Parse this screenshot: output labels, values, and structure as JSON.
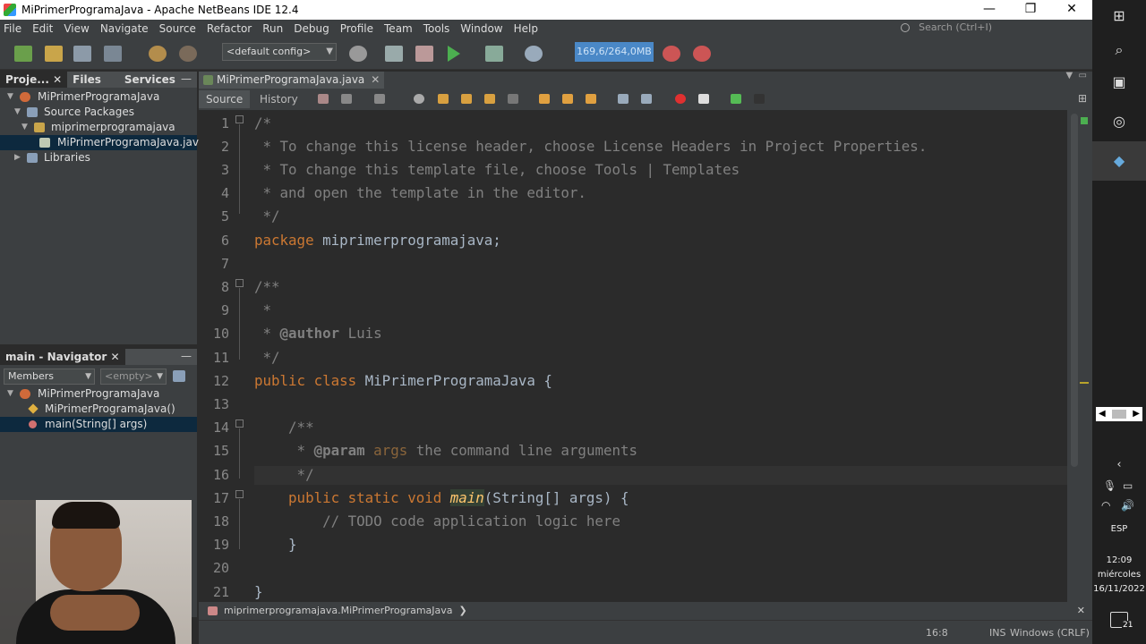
{
  "window": {
    "title": "MiPrimerProgramaJava - Apache NetBeans IDE 12.4",
    "minimize": "—",
    "maximize": "❐",
    "close": "✕"
  },
  "menu": [
    "File",
    "Edit",
    "View",
    "Navigate",
    "Source",
    "Refactor",
    "Run",
    "Debug",
    "Profile",
    "Team",
    "Tools",
    "Window",
    "Help"
  ],
  "search": {
    "placeholder": "Search (Ctrl+I)"
  },
  "toolbar": {
    "config": "<default config>",
    "memory": "169,6/264,0MB"
  },
  "projects_panel": {
    "tabs": [
      "Proje...",
      "Files",
      "Services"
    ],
    "tree": [
      {
        "label": "MiPrimerProgramaJava",
        "icon": "project-icon"
      },
      {
        "label": "Source Packages",
        "icon": "source-packages-icon"
      },
      {
        "label": "miprimerprogramajava",
        "icon": "package-icon"
      },
      {
        "label": "MiPrimerProgramaJava.java",
        "icon": "java-file-icon"
      },
      {
        "label": "Libraries",
        "icon": "libraries-icon"
      }
    ]
  },
  "navigator": {
    "title": "main - Navigator",
    "filter": "Members",
    "empty": "<empty>",
    "items": [
      {
        "label": "MiPrimerProgramaJava"
      },
      {
        "label": "MiPrimerProgramaJava()"
      },
      {
        "label": "main(String[] args)"
      }
    ]
  },
  "editor": {
    "tab": "MiPrimerProgramaJava.java",
    "source_tab": "Source",
    "history_tab": "History",
    "lines": [
      "1",
      "2",
      "3",
      "4",
      "5",
      "6",
      "7",
      "8",
      "9",
      "10",
      "11",
      "12",
      "13",
      "14",
      "15",
      "16",
      "17",
      "18",
      "19",
      "20",
      "21"
    ],
    "code": {
      "l1": "/*",
      "l2": " * To change this license header, choose License Headers in Project Properties.",
      "l3": " * To change this template file, choose Tools | Templates",
      "l4": " * and open the template in the editor.",
      "l5": " */",
      "l6_kw": "package",
      "l6_rest": " miprimerprogramajava;",
      "l8": "/**",
      "l9": " *",
      "l10_pre": " * ",
      "l10_tag": "@author",
      "l10_rest": " Luis",
      "l11": " */",
      "l12_kw": "public class",
      "l12_rest": " MiPrimerProgramaJava {",
      "l14": "    /**",
      "l15_pre": "     * ",
      "l15_tag": "@param",
      "l15_param": " args",
      "l15_rest": " the command line arguments",
      "l16": "     */",
      "l17_kw": "    public static void",
      "l17_meth": "main",
      "l17_rest": "(String[] args) {",
      "l18": "        // TODO code application logic here",
      "l19": "    }",
      "l21": "}"
    }
  },
  "breadcrumb": "miprimerprogramajava.MiPrimerProgramaJava",
  "status": {
    "position": "16:8",
    "mode": "INS",
    "line_ending": "Windows (CRLF)"
  },
  "taskbar": {
    "lang": "ESP",
    "time": "12:09",
    "day": "miércoles",
    "date": "16/11/2022",
    "notifications": "21"
  },
  "colors": {
    "accent": "#4a88c7",
    "keyword": "#cc7832",
    "comment": "#808080",
    "method": "#ffc66d"
  }
}
